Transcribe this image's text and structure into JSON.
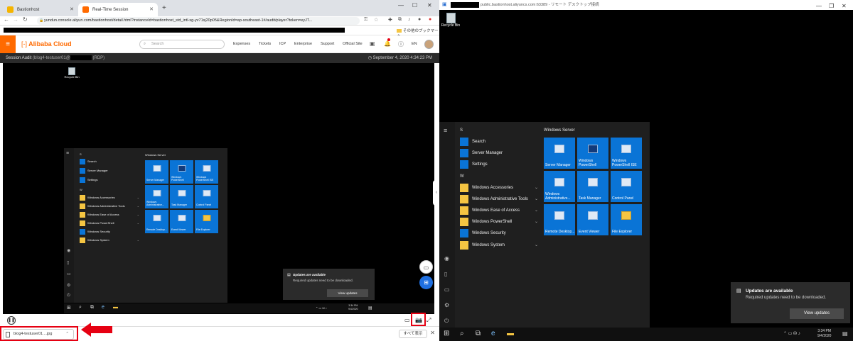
{
  "browser": {
    "tabs": [
      {
        "label": "Bastionhost",
        "favicon_color": "#f5b400"
      },
      {
        "label": "Real-Time Session",
        "favicon_color": "#ff6a00"
      }
    ],
    "new_tab": "+",
    "url": "yundun.console.aliyun.com/bastionhost/detail.html?instanceId=bastionhost_std_intl-sg-yv71sj20p05&RegionId=ap-southeast-1#/audit/player?token=eyJT...",
    "bookmarks_other": "その他のブックマーク"
  },
  "console": {
    "brand": "Alibaba Cloud",
    "search_placeholder": "Search",
    "nav": [
      "Expenses",
      "Tickets",
      "ICP",
      "Enterprise",
      "Support",
      "Official Site"
    ],
    "lang": "EN",
    "accent": "#ff6a00"
  },
  "session": {
    "title_prefix": "Session Audit",
    "user": "(blog4-testuser01@",
    "protocol": "(RDP)",
    "timestamp": "September 4, 2020 4:34:23 PM"
  },
  "download": {
    "file": "blog4-testuser01....jpg",
    "show_all": "すべて表示"
  },
  "rdp_window": {
    "title_suffix": "public.bastionhost.aliyuncs.com:63389 - リモート デスクトップ接続"
  },
  "desktop": {
    "recycle_bin": "Recycle Bin",
    "start": {
      "section_s": "S",
      "section_w": "W",
      "s_items": [
        "Search",
        "Server Manager",
        "Settings"
      ],
      "w_items": [
        "Windows Accessories",
        "Windows Administrative Tools",
        "Windows Ease of Access",
        "Windows PowerShell",
        "Windows Security",
        "Windows System"
      ],
      "tiles_header": "Windows Server",
      "tiles": [
        "Server Manager",
        "Windows PowerShell",
        "Windows PowerShell ISE",
        "Windows Administrative...",
        "Task Manager",
        "Control Panel",
        "Remote Desktop...",
        "Event Viewer",
        "File Explorer"
      ]
    },
    "notification": {
      "title": "Updates are available",
      "body": "Required updates need to be downloaded.",
      "button": "View updates"
    },
    "clock": {
      "time": "3:34 PM",
      "date": "9/4/2020"
    }
  },
  "colors": {
    "highlight": "#e60012",
    "tile": "#0a74d6",
    "float_button": "#1f6fe0"
  }
}
